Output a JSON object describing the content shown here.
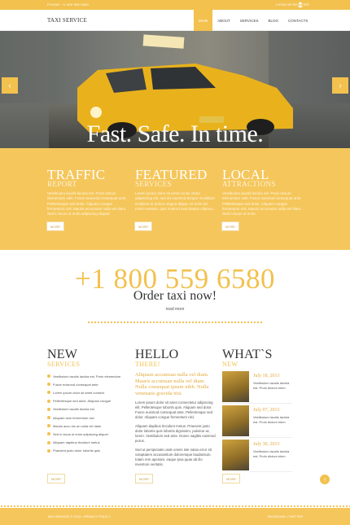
{
  "topbar": {
    "phone": "PHONE: +1 800 559 6580",
    "login": "LOGIN OR REGISTER",
    "user_icon": "user-icon"
  },
  "header": {
    "logo": "TAXI SERVICE",
    "nav": [
      "MAIN",
      "ABOUT",
      "SERVICES",
      "BLOG",
      "CONTACTS"
    ],
    "active_index": 0
  },
  "hero": {
    "title": "Fast. Safe. In time.",
    "prev_icon": "chevron-left-icon",
    "next_icon": "chevron-right-icon"
  },
  "features": [
    {
      "title": "TRAFFIC",
      "sub": "REPORT",
      "text": "Vestibulum iaculis lacinia est. Proin dictum elementum velit. Fusce euismod consequat ante. Pellentesque sed dolor. Aliquam congue fermentum nisl. Mauris accumsan nulla vel diam. Sed in lacus ut enim adipiscing aliquet.",
      "button": "MORE"
    },
    {
      "title": "FEATURED",
      "sub": "SERVICES",
      "text": "Lorem ipsum dolor sit amet conse ctetur adipisicing elit, sed do eiusmod tempor incididunt ut labore et dolore magna aliqua. Ut enim ad minim veniam, quis nostrud exercitation ullamco.",
      "button": "MORE"
    },
    {
      "title": "LOCAL",
      "sub": "ATTRACTIONS",
      "text": "Vestibulum iaculis lacinia est. Proin dictum elementum velit. Fusce euismod consequat ante. Pellentesque sed dolor. Aliquam congue fermentum nisl. Mauris accumsan nulla vel diam. Sed in lacus ut enim.",
      "button": "MORE"
    }
  ],
  "call": {
    "phone": "+1 800 559 6580",
    "order": "Order taxi now!",
    "readmore": "read more"
  },
  "new_services": {
    "title": "NEW",
    "sub": "SERVICES",
    "items": [
      "Vestibulum iaculis lacinia est. Proin elementum",
      "Fusce euismod consequat ante",
      "Lorem ipsum dolor sit amet consect",
      "Pellentesque sed dolor. Aliquam congue",
      "Vestibulum iaculis lacinia est",
      "Aliquam sem fermentum nisl",
      "Mauris accu ms an nulla vel diam",
      "Sed in lacus ut enim adipiscing aliquet",
      "Aliquam dapibus tincidunt metus",
      "Praesent justo dolor lobortis quis"
    ],
    "button": "MORE"
  },
  "hello": {
    "title": "HELLO",
    "sub": "THERE!",
    "lead": "Aliquam accumsan nulla vel diam. Mauris accumsan nulla vel diam. Nulla consequat ipsum nibh. Nulla venenatis gravida nisi.",
    "p1": "Lorem ipsum dolor sit amet consectetur adipiscing elit. Pellentesque lobortis quis. Aliquam sed dolor. Fusce euismod consequat ante. Pellentesque sed dolor. Aliquam congue fermentum nisl.",
    "p2": "Aliquam dapibus tincidunt metus. Praesent justo dolor lobortis quis lobortis dignissim, pulvinar ac, lorem. Vestibulum sed ante. Donec sagittis euismod purus.",
    "p3": "Sed ut perspiciatis unde omnis iste natus error sit voluptatem accusantium doloremque laudantium, totam rem aperiam, eaque ipsa quae ab illo inventore veritatis.",
    "button": "MORE"
  },
  "whats_new": {
    "title": "WHAT`S",
    "sub": "NEW",
    "items": [
      {
        "date": "July 18, 2013",
        "text": "Vestibulum iaculis lacinia est. Proin dictum elem"
      },
      {
        "date": "July 07, 2013",
        "text": "Vestibulum iaculis lacinia est. Proin dictum elem"
      },
      {
        "date": "July 30, 2013",
        "text": "Vestibulum iaculis lacinia est. Proin dictum elem"
      }
    ],
    "button": "MORE"
  },
  "footer": {
    "copy": "TAXI SERVICE © 2013 • PRIVACY POLICY",
    "social": "FACEBOOK • TWITTER"
  }
}
